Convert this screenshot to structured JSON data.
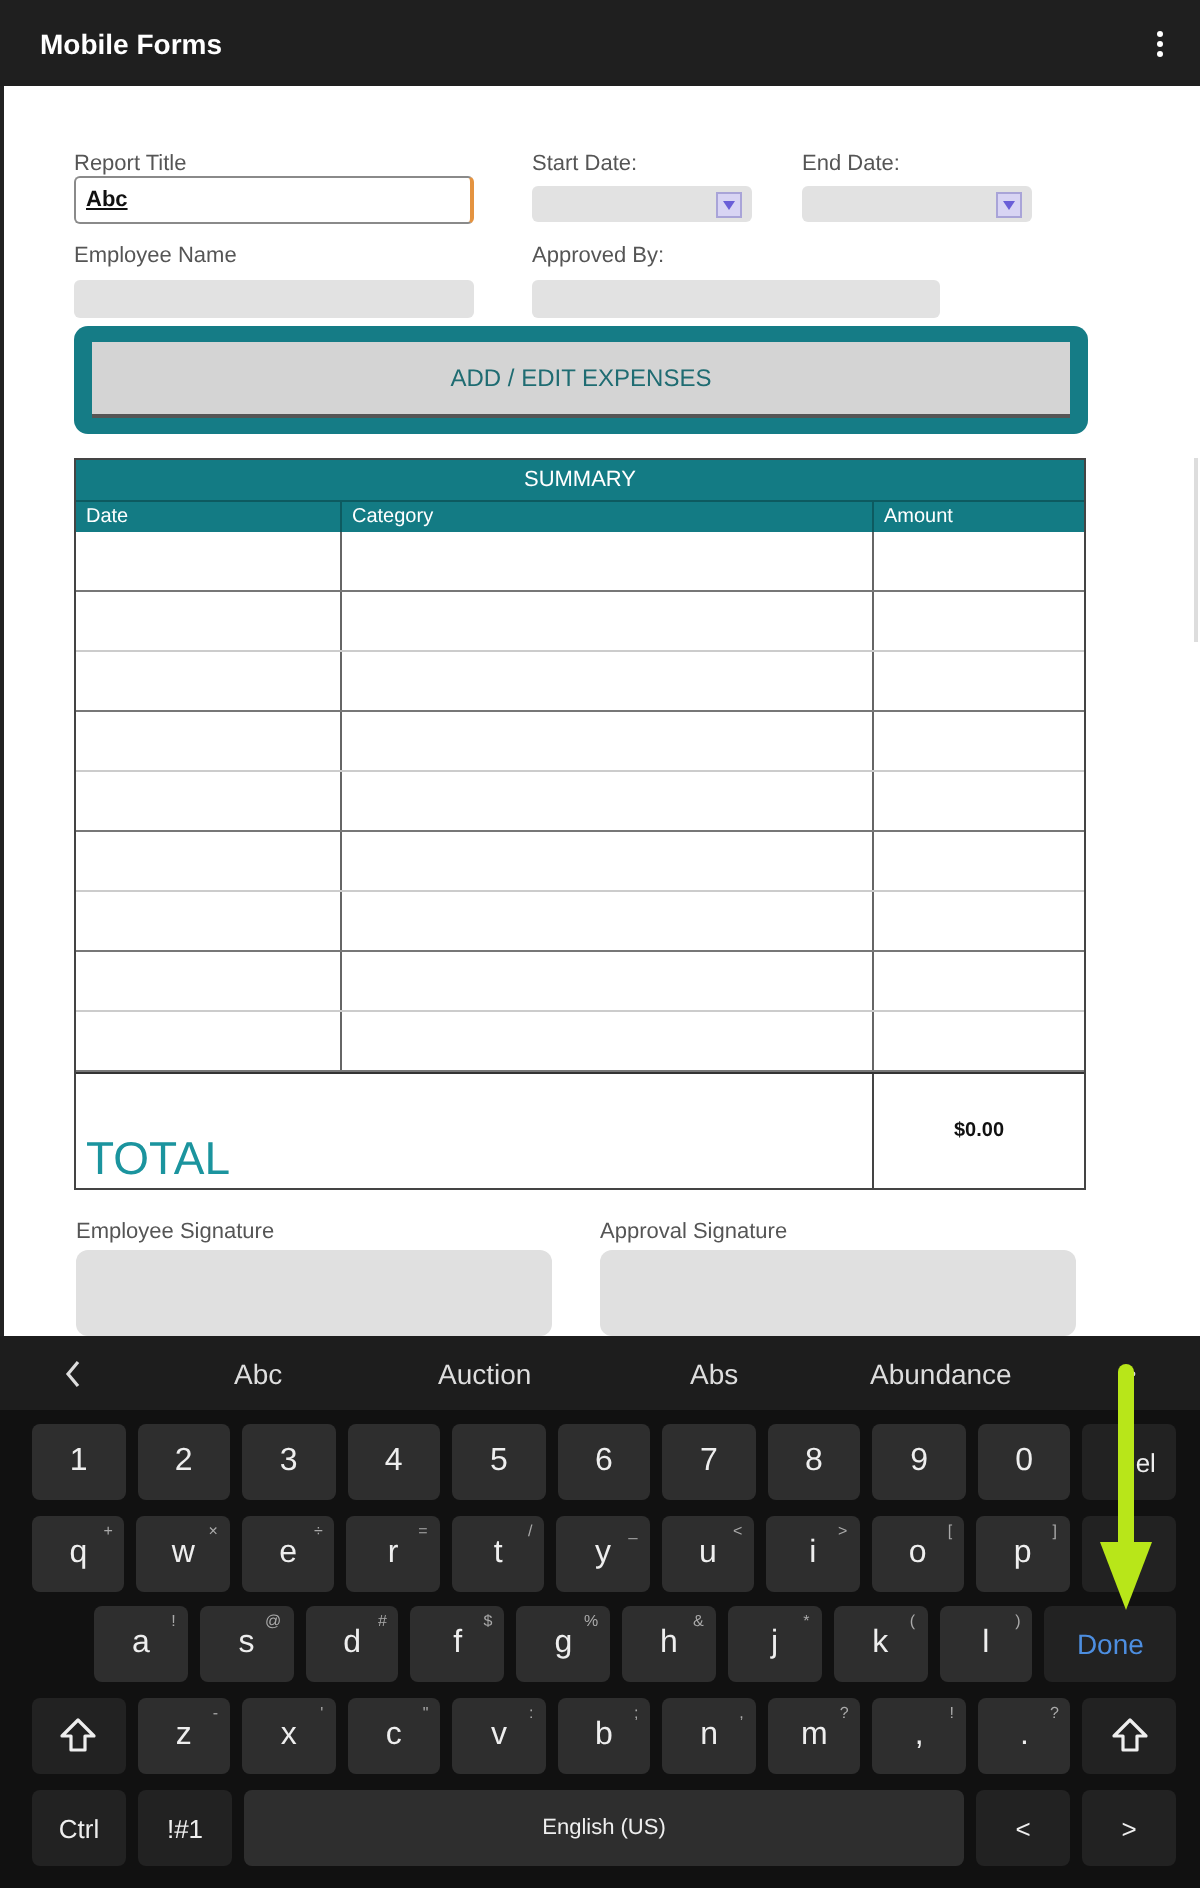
{
  "app_bar": {
    "title": "Mobile Forms"
  },
  "form": {
    "fields": [
      {
        "kind": "text",
        "label": "Report Title",
        "value": "Abc",
        "focused": true
      },
      {
        "kind": "date",
        "label": "Start Date:"
      },
      {
        "kind": "date",
        "label": "End Date:"
      },
      {
        "kind": "text",
        "label": "Employee Name",
        "focused": false
      },
      {
        "kind": "text",
        "label": "Approved By:",
        "focused": false
      }
    ],
    "expenses_button": "ADD / EDIT EXPENSES",
    "summary": {
      "title": "SUMMARY",
      "columns": [
        "Date",
        "Category",
        "Amount"
      ],
      "total_label": "TOTAL",
      "total_amount": "$0.00"
    },
    "signatures": [
      "Employee Signature",
      "Approval Signature"
    ]
  },
  "keyboard": {
    "suggestions": [
      "Abc",
      "Auction",
      "Abs",
      "Abundance"
    ],
    "rows": [
      {
        "keys": [
          {
            "kind": "char",
            "label": "1"
          },
          {
            "kind": "char",
            "label": "2"
          },
          {
            "kind": "char",
            "label": "3"
          },
          {
            "kind": "char",
            "label": "4"
          },
          {
            "kind": "char",
            "label": "5"
          },
          {
            "kind": "char",
            "label": "6"
          },
          {
            "kind": "char",
            "label": "7"
          },
          {
            "kind": "char",
            "label": "8"
          },
          {
            "kind": "char",
            "label": "9"
          },
          {
            "kind": "char",
            "label": "0"
          },
          {
            "kind": "action",
            "label": "el"
          }
        ]
      },
      {
        "keys": [
          {
            "kind": "char",
            "label": "q",
            "alt": "+"
          },
          {
            "kind": "char",
            "label": "w",
            "alt": "×"
          },
          {
            "kind": "char",
            "label": "e",
            "alt": "÷"
          },
          {
            "kind": "char",
            "label": "r",
            "alt": "="
          },
          {
            "kind": "char",
            "label": "t",
            "alt": "/"
          },
          {
            "kind": "char",
            "label": "y",
            "alt": "_"
          },
          {
            "kind": "char",
            "label": "u",
            "alt": "<"
          },
          {
            "kind": "char",
            "label": "i",
            "alt": ">"
          },
          {
            "kind": "char",
            "label": "o",
            "alt": "["
          },
          {
            "kind": "char",
            "label": "p",
            "alt": "]"
          },
          {
            "kind": "blank"
          }
        ]
      },
      {
        "keys": [
          {
            "kind": "char",
            "label": "a",
            "alt": "!"
          },
          {
            "kind": "char",
            "label": "s",
            "alt": "@"
          },
          {
            "kind": "char",
            "label": "d",
            "alt": "#"
          },
          {
            "kind": "char",
            "label": "f",
            "alt": "$"
          },
          {
            "kind": "char",
            "label": "g",
            "alt": "%"
          },
          {
            "kind": "char",
            "label": "h",
            "alt": "&"
          },
          {
            "kind": "char",
            "label": "j",
            "alt": "*"
          },
          {
            "kind": "char",
            "label": "k",
            "alt": "("
          },
          {
            "kind": "char",
            "label": "l",
            "alt": ")"
          },
          {
            "kind": "done",
            "label": "Done"
          }
        ]
      },
      {
        "keys": [
          {
            "kind": "shift"
          },
          {
            "kind": "char",
            "label": "z",
            "alt": "-"
          },
          {
            "kind": "char",
            "label": "x",
            "alt": "'"
          },
          {
            "kind": "char",
            "label": "c",
            "alt": "\""
          },
          {
            "kind": "char",
            "label": "v",
            "alt": ":"
          },
          {
            "kind": "char",
            "label": "b",
            "alt": ";"
          },
          {
            "kind": "char",
            "label": "n",
            "alt": ","
          },
          {
            "kind": "char",
            "label": "m",
            "alt": "?"
          },
          {
            "kind": "char",
            "label": ",",
            "alt": "!"
          },
          {
            "kind": "char",
            "label": ".",
            "alt": "?"
          },
          {
            "kind": "shift"
          }
        ]
      },
      {
        "keys": [
          {
            "kind": "action",
            "label": "Ctrl"
          },
          {
            "kind": "action",
            "label": "!#1"
          },
          {
            "kind": "space",
            "label": "English (US)"
          },
          {
            "kind": "action",
            "label": "<"
          },
          {
            "kind": "action",
            "label": ">"
          }
        ]
      }
    ]
  }
}
